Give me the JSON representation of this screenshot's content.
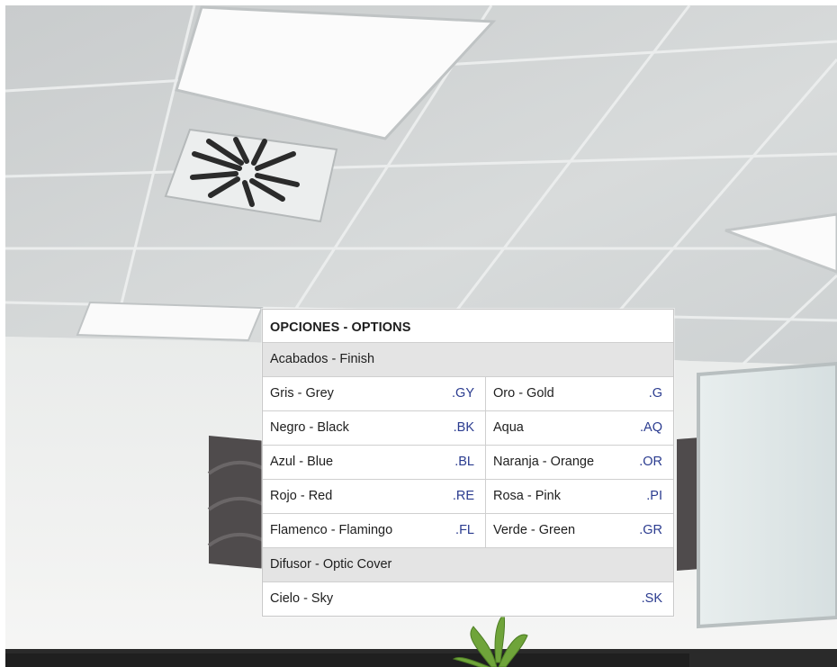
{
  "options": {
    "title": "OPCIONES - OPTIONS",
    "finish_header": "Acabados - Finish",
    "finish_rows": [
      {
        "left": {
          "label": "Gris - Grey",
          "code": ".GY"
        },
        "right": {
          "label": "Oro - Gold",
          "code": ".G"
        }
      },
      {
        "left": {
          "label": "Negro - Black",
          "code": ".BK"
        },
        "right": {
          "label": "Aqua",
          "code": ".AQ"
        }
      },
      {
        "left": {
          "label": "Azul - Blue",
          "code": ".BL"
        },
        "right": {
          "label": "Naranja - Orange",
          "code": ".OR"
        }
      },
      {
        "left": {
          "label": "Rojo - Red",
          "code": ".RE"
        },
        "right": {
          "label": "Rosa - Pink",
          "code": ".PI"
        }
      },
      {
        "left": {
          "label": "Flamenco - Flamingo",
          "code": ".FL"
        },
        "right": {
          "label": "Verde - Green",
          "code": ".GR"
        }
      }
    ],
    "cover_header": "Difusor - Optic Cover",
    "cover_rows": [
      {
        "label": "Cielo - Sky",
        "code": ".SK"
      }
    ]
  },
  "colors": {
    "code_text": "#2a3b8f",
    "section_bg": "#e4e4e4"
  }
}
